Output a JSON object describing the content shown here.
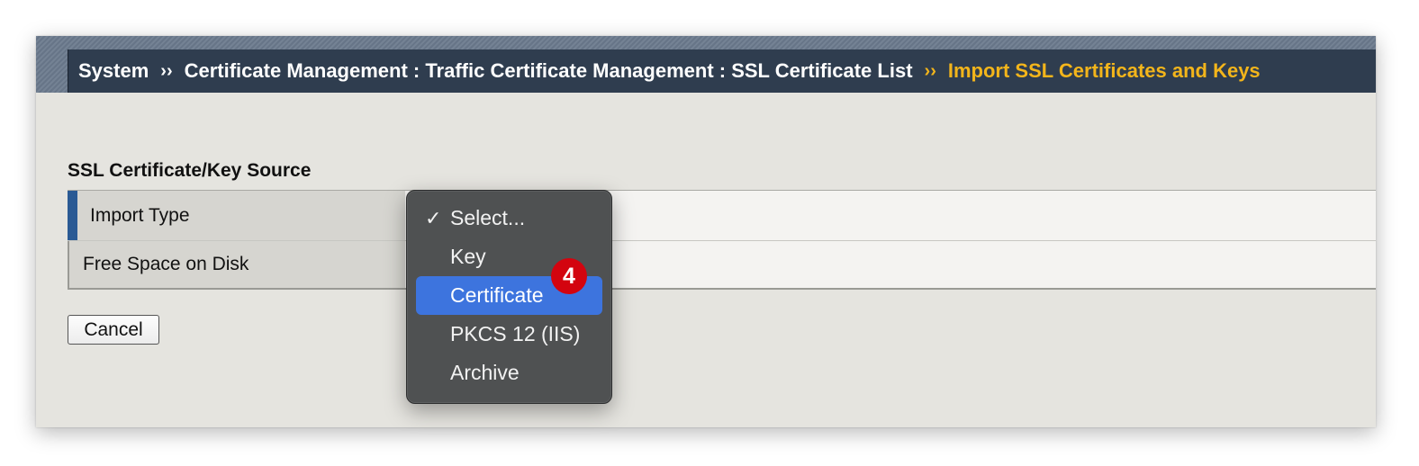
{
  "breadcrumb": {
    "items": [
      "System",
      "Certificate Management : Traffic Certificate Management : SSL Certificate List"
    ],
    "separator": "››",
    "current": "Import SSL Certificates and Keys",
    "current_color": "#f3b51b"
  },
  "section": {
    "title": "SSL Certificate/Key Source"
  },
  "form": {
    "rows": [
      {
        "label": "Import Type",
        "required": true
      },
      {
        "label": "Free Space on Disk",
        "required": false
      }
    ]
  },
  "buttons": {
    "cancel": "Cancel"
  },
  "dropdown": {
    "checkmark": "✓",
    "options": [
      "Select...",
      "Key",
      "Certificate",
      "PKCS 12 (IIS)",
      "Archive"
    ],
    "selected_index": 0,
    "highlighted_index": 2,
    "highlight_color": "#3d74de"
  },
  "annotation": {
    "badge": "4",
    "badge_color": "#d3040f"
  }
}
